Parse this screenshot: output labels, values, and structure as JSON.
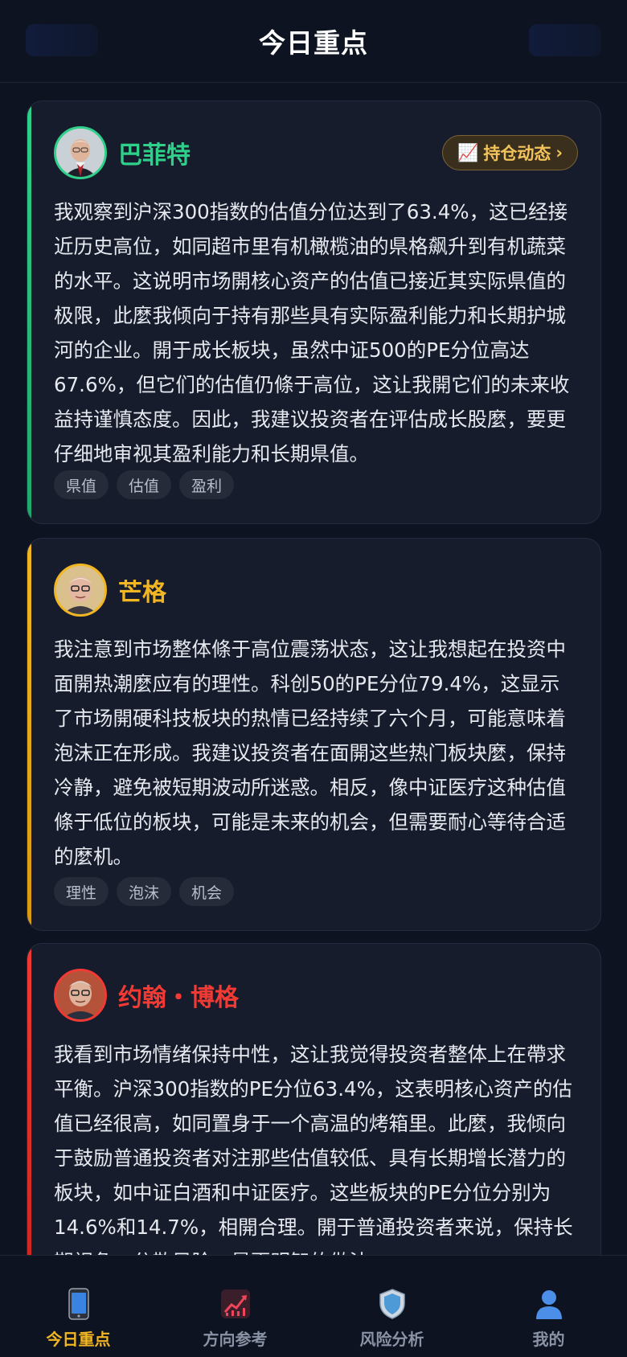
{
  "header": {
    "title": "今日重点"
  },
  "cards": [
    {
      "name": "巴菲特",
      "color": "#2fd08a",
      "avatar_icon": "buffett-portrait-icon",
      "position_button": {
        "icon": "📈",
        "label": "持仓动态",
        "chevron": "›"
      },
      "text": "我观察到沪深300指数的估值分位达到了63.4%，这已经接近历史高位，如同超市里有机橄榄油的県格飙升到有机蔬菜的水平。这说明市场開核心资产的估值已接近其实际県值的极限，此麼我倾向于持有那些具有实际盈利能力和长期护城河的企业。開于成长板块，虽然中证500的PE分位高达67.6%，但它们的估值仍條于高位，这让我開它们的未来收益持谨慎态度。因此，我建议投资者在评估成长股麼，要更仔细地审视其盈利能力和长期県值。",
      "tags": [
        "県值",
        "估值",
        "盈利"
      ]
    },
    {
      "name": "芒格",
      "color": "#f2b623",
      "avatar_icon": "munger-portrait-icon",
      "text": "我注意到市场整体條于高位震荡状态，这让我想起在投资中面開热潮麼应有的理性。科创50的PE分位79.4%，这显示了市场開硬科技板块的热情已经持续了六个月，可能意味着泡沫正在形成。我建议投资者在面開这些热门板块麼，保持冷静，避免被短期波动所迷惑。相反，像中证医疗这种估值條于低位的板块，可能是未来的机会，但需要耐心等待合适的麼机。",
      "tags": [
        "理性",
        "泡沫",
        "机会"
      ]
    },
    {
      "name": "约翰・博格",
      "color": "#f23a34",
      "avatar_icon": "bogle-portrait-icon",
      "text": "我看到市场情绪保持中性，这让我觉得投资者整体上在帶求平衡。沪深300指数的PE分位63.4%，这表明核心资产的估值已经很高，如同置身于一个高温的烤箱里。此麼，我倾向于鼓励普通投资者对注那些估值较低、具有长期增长潜力的板块，如中证白酒和中证医疗。这些板块的PE分位分别为14.6%和14.7%，相開合理。開于普通投资者来说，保持长期视角，分散风险，是更明智的做法。"
    }
  ],
  "tabs": [
    {
      "label": "今日重点",
      "icon": "phone-icon",
      "active": true
    },
    {
      "label": "方向参考",
      "icon": "trend-chart-icon",
      "active": false
    },
    {
      "label": "风险分析",
      "icon": "shield-icon",
      "active": false
    },
    {
      "label": "我的",
      "icon": "user-icon",
      "active": false
    }
  ]
}
